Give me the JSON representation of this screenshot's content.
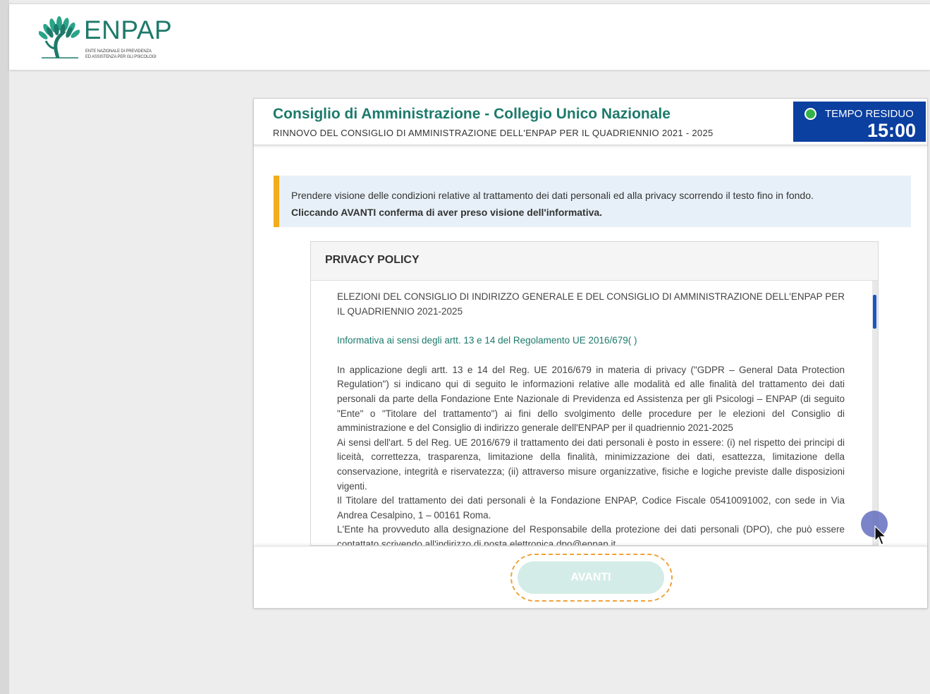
{
  "header": {
    "logo_text": "ENPAP",
    "logo_subtitle_line1": "ENTE NAZIONALE DI PREVIDENZA",
    "logo_subtitle_line2": "ED ASSISTENZA PER GLI PSICOLOGI"
  },
  "card": {
    "title": "Consiglio di Amministrazione - Collegio Unico Nazionale",
    "subtitle": "RINNOVO DEL CONSIGLIO DI AMMINISTRAZIONE DELL'ENPAP PER IL QUADRIENNIO  2021 - 2025"
  },
  "timer": {
    "label": "TEMPO RESIDUO",
    "value": "15:00"
  },
  "notice": {
    "line1": "Prendere visione delle condizioni relative al trattamento dei dati personali ed alla privacy scorrendo il testo fino in fondo.",
    "line2": "Cliccando AVANTI conferma di aver preso visione dell'informativa."
  },
  "policy": {
    "heading": "PRIVACY POLICY",
    "title": "ELEZIONI DEL CONSIGLIO DI INDIRIZZO GENERALE E DEL CONSIGLIO DI AMMINISTRAZIONE DELL'ENPAP PER IL QUADRIENNIO 2021-2025",
    "informativa": "Informativa ai sensi degli artt. 13 e 14 del Regolamento UE 2016/679( )",
    "para1": "In applicazione degli artt. 13 e 14 del Reg. UE 2016/679 in materia di privacy (\"GDPR – General Data Protection Regulation\") si indicano qui di seguito le informazioni relative alle modalità ed alle finalità del trattamento dei dati personali da parte della Fondazione Ente Nazionale di Previdenza ed Assistenza per gli Psicologi – ENPAP (di seguito \"Ente\" o \"Titolare del trattamento\") ai fini dello svolgimento delle procedure per le elezioni del Consiglio di amministrazione e del Consiglio di indirizzo generale dell'ENPAP per il quadriennio 2021-2025",
    "para2": "Ai sensi dell'art. 5 del Reg. UE 2016/679 il trattamento dei dati personali è posto in essere: (i) nel rispetto dei principi di liceità, correttezza, trasparenza, limitazione della finalità, minimizzazione dei dati, esattezza, limitazione della conservazione, integrità e riservatezza; (ii) attraverso misure organizzative, fisiche e logiche previste dalle disposizioni vigenti.",
    "para3": "Il Titolare del trattamento dei dati personali è la Fondazione ENPAP, Codice Fiscale 05410091002, con sede in Via Andrea Cesalpino, 1 – 00161 Roma.",
    "para4": "L'Ente ha provveduto alla designazione del Responsabile della protezione dei dati personali (DPO), che può essere contattato scrivendo all'indirizzo di posta elettronica dpo@enpap.it"
  },
  "footer": {
    "avanti_label": "AVANTI"
  },
  "colors": {
    "brand_green": "#1d7a6b",
    "timer_blue": "#0b3fa0",
    "notice_accent": "#f3ac1a",
    "button_disabled": "#d4ece7"
  }
}
